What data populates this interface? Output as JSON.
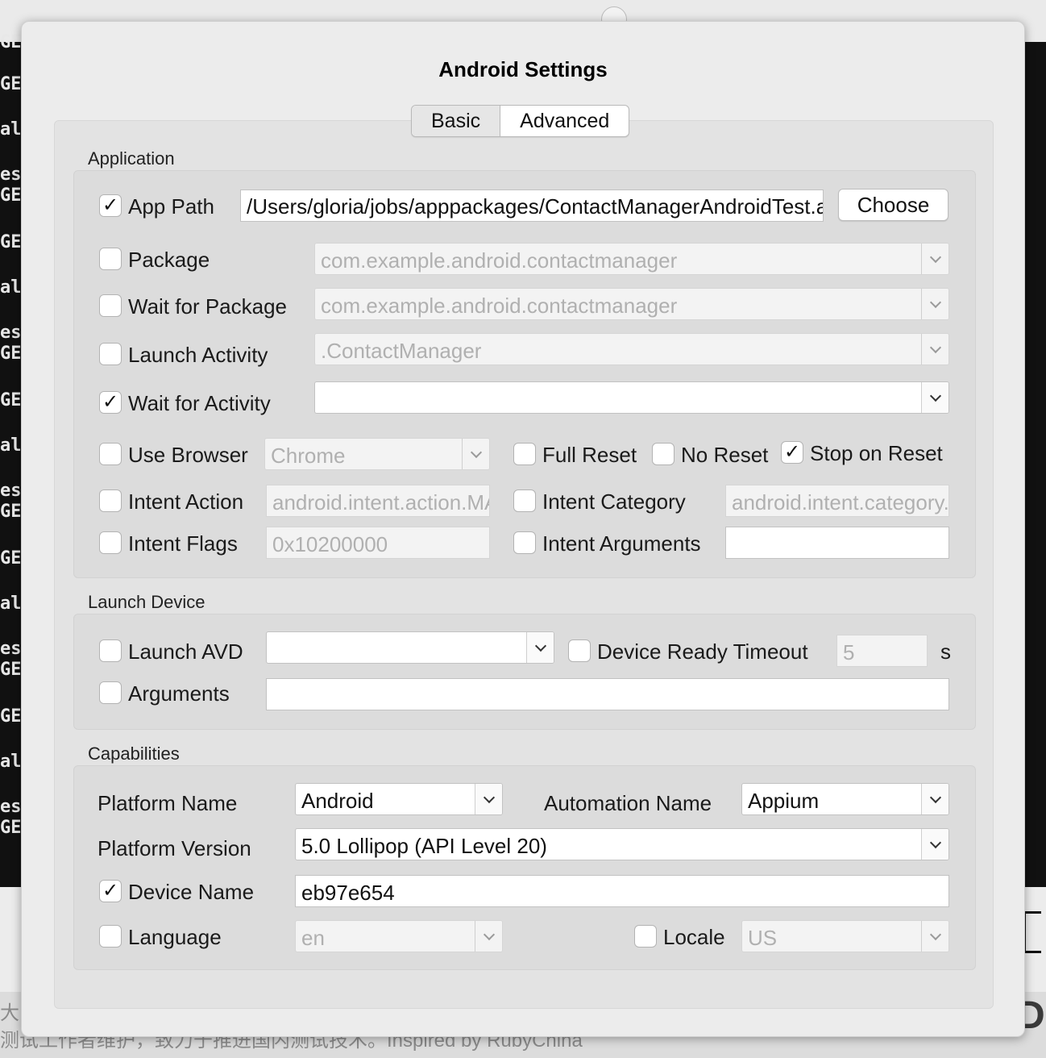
{
  "background": {
    "terminal_lines": [
      "GE",
      "GE",
      "al",
      "es",
      "GE",
      "GE",
      "al",
      "es",
      "GE",
      "GE",
      "al",
      "es",
      "GE",
      "GE",
      "al",
      "es",
      "GE",
      "GE",
      "al",
      "es",
      "GE"
    ],
    "footer_line1": "大",
    "footer_line2": "测试工作者维护，致力于推进国内测试技术。Inspired by RubyChina"
  },
  "dialog": {
    "title": "Android Settings",
    "tabs": [
      {
        "label": "Basic",
        "selected": true
      },
      {
        "label": "Advanced",
        "selected": false
      }
    ]
  },
  "application": {
    "group_label": "Application",
    "app_path": {
      "checked": true,
      "label": "App Path",
      "value": "/Users/gloria/jobs/apppackages/ContactManagerAndroidTest.apk",
      "choose_label": "Choose"
    },
    "package": {
      "checked": false,
      "label": "Package",
      "value": "com.example.android.contactmanager"
    },
    "wait_for_package": {
      "checked": false,
      "label": "Wait for Package",
      "value": "com.example.android.contactmanager"
    },
    "launch_activity": {
      "checked": false,
      "label": "Launch Activity",
      "value": ".ContactManager"
    },
    "wait_for_activity": {
      "checked": true,
      "label": "Wait for Activity",
      "value": ""
    },
    "use_browser": {
      "checked": false,
      "label": "Use Browser",
      "value": "Chrome"
    },
    "full_reset": {
      "checked": false,
      "label": "Full Reset"
    },
    "no_reset": {
      "checked": false,
      "label": "No Reset"
    },
    "stop_on_reset": {
      "checked": true,
      "label": "Stop on Reset"
    },
    "intent_action": {
      "checked": false,
      "label": "Intent Action",
      "value": "android.intent.action.MAIN"
    },
    "intent_category": {
      "checked": false,
      "label": "Intent Category",
      "value": "android.intent.category.LAUNCHER"
    },
    "intent_flags": {
      "checked": false,
      "label": "Intent Flags",
      "value": "0x10200000"
    },
    "intent_arguments": {
      "checked": false,
      "label": "Intent Arguments",
      "value": ""
    }
  },
  "launch_device": {
    "group_label": "Launch Device",
    "launch_avd": {
      "checked": false,
      "label": "Launch AVD",
      "value": ""
    },
    "device_ready_timeout": {
      "checked": false,
      "label": "Device Ready Timeout",
      "value": "5",
      "unit": "s"
    },
    "arguments": {
      "checked": false,
      "label": "Arguments",
      "value": ""
    }
  },
  "capabilities": {
    "group_label": "Capabilities",
    "platform_name": {
      "label": "Platform Name",
      "value": "Android"
    },
    "automation_name": {
      "label": "Automation Name",
      "value": "Appium"
    },
    "platform_version": {
      "label": "Platform Version",
      "value": "5.0 Lollipop (API Level 20)"
    },
    "device_name": {
      "checked": true,
      "label": "Device Name",
      "value": "eb97e654"
    },
    "language": {
      "checked": false,
      "label": "Language",
      "value": "en"
    },
    "locale": {
      "checked": false,
      "label": "Locale",
      "value": "US"
    }
  }
}
